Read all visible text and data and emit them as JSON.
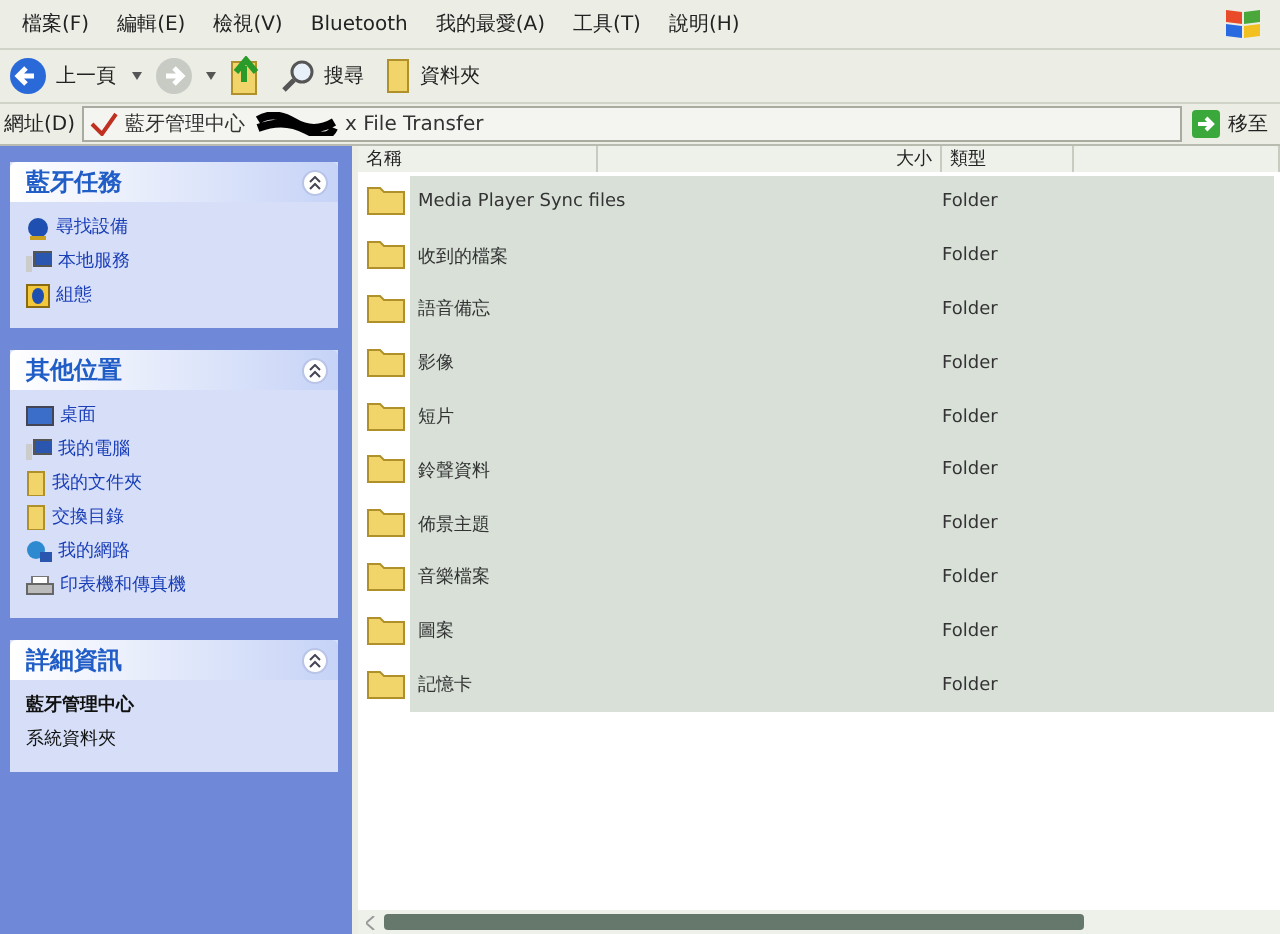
{
  "menu": [
    "檔案(F)",
    "編輯(E)",
    "檢視(V)",
    "Bluetooth",
    "我的最愛(A)",
    "工具(T)",
    "說明(H)"
  ],
  "toolbar": {
    "back": "上一頁",
    "search": "搜尋",
    "folders": "資料夾"
  },
  "address": {
    "label": "網址(D)",
    "value_start": "藍牙管理中心",
    "value_end": "x File Transfer",
    "go": "移至"
  },
  "sidebar": [
    {
      "title": "藍牙任務",
      "expanded": true,
      "kind": "links",
      "items": [
        {
          "label": "尋找設備"
        },
        {
          "label": "本地服務"
        },
        {
          "label": "組態"
        }
      ]
    },
    {
      "title": "其他位置",
      "expanded": true,
      "kind": "links",
      "items": [
        {
          "label": "桌面"
        },
        {
          "label": "我的電腦"
        },
        {
          "label": "我的文件夾"
        },
        {
          "label": "交換目錄"
        },
        {
          "label": "我的網路"
        },
        {
          "label": "印表機和傳真機"
        }
      ]
    },
    {
      "title": "詳細資訊",
      "expanded": true,
      "kind": "details",
      "items": [
        {
          "label": "藍牙管理中心"
        },
        {
          "label": "系統資料夾"
        }
      ]
    }
  ],
  "table": {
    "columns": [
      "名稱",
      "大小",
      "類型"
    ],
    "rows": [
      {
        "name": "Media Player Sync files",
        "type": "Folder",
        "selected": true
      },
      {
        "name": "收到的檔案",
        "type": "Folder",
        "selected": true
      },
      {
        "name": "語音備忘",
        "type": "Folder",
        "selected": true
      },
      {
        "name": "影像",
        "type": "Folder",
        "selected": true
      },
      {
        "name": "短片",
        "type": "Folder",
        "selected": true
      },
      {
        "name": "鈴聲資料",
        "type": "Folder",
        "selected": true
      },
      {
        "name": "佈景主題",
        "type": "Folder",
        "selected": true
      },
      {
        "name": "音樂檔案",
        "type": "Folder",
        "selected": true
      },
      {
        "name": "圖案",
        "type": "Folder",
        "selected": true
      },
      {
        "name": "記憶卡",
        "type": "Folder",
        "selected": true
      }
    ]
  }
}
